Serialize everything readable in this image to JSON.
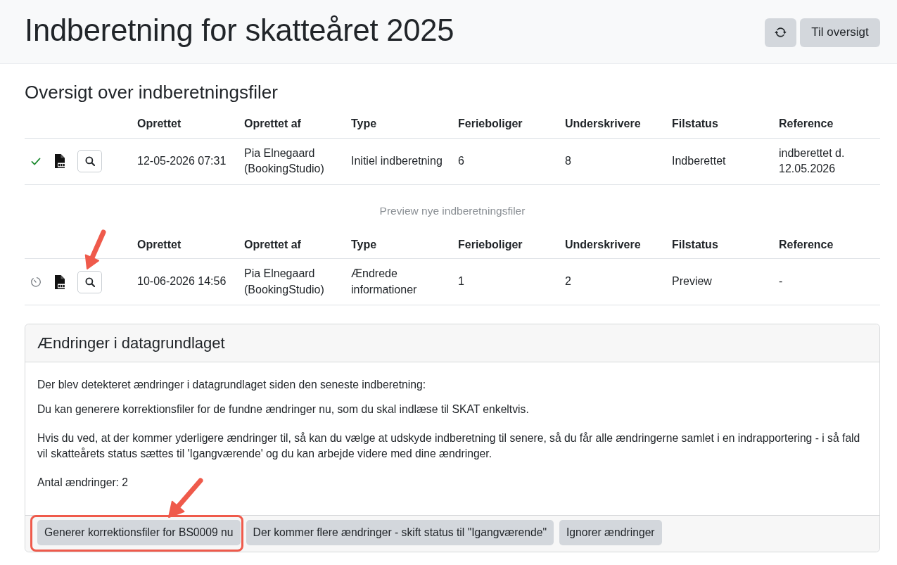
{
  "header": {
    "title": "Indberetning for skatteåret 2025",
    "overview_button": "Til oversigt"
  },
  "files_table": {
    "heading": "Oversigt over indberetningsfiler",
    "columns": [
      "Oprettet",
      "Oprettet af",
      "Type",
      "Ferieboliger",
      "Underskrivere",
      "Filstatus",
      "Reference"
    ],
    "rows": [
      {
        "kind": "submitted",
        "annotated": false,
        "cells": [
          "12-05-2026 07:31",
          "Pia Elnegaard (BookingStudio)",
          "Initiel indberetning",
          "6",
          "8",
          "Indberettet",
          "indberettet d. 12.05.2026"
        ]
      }
    ]
  },
  "preview_table": {
    "caption": "Preview nye indberetningsfiler",
    "columns": [
      "Oprettet",
      "Oprettet af",
      "Type",
      "Ferieboliger",
      "Underskrivere",
      "Filstatus",
      "Reference"
    ],
    "rows": [
      {
        "kind": "preview",
        "annotated": true,
        "cells": [
          "10-06-2026 14:56",
          "Pia Elnegaard (BookingStudio)",
          "Ændrede informationer",
          "1",
          "2",
          "Preview",
          "-"
        ]
      }
    ]
  },
  "changes_card": {
    "title": "Ændringer i datagrundlaget",
    "paragraphs": [
      "Der blev detekteret ændringer i datagrundlaget siden den seneste indberetning:",
      "Du kan generere korrektionsfiler for de fundne ændringer nu, som du skal indlæse til SKAT enkeltvis.",
      "Hvis du ved, at der kommer yderligere ændringer til, så kan du vælge at udskyde indberetning til senere, så du får alle ændringerne samlet i en indrapportering - i så fald vil skatteårets status sættes til 'Igangværende' og du kan arbejde videre med dine ændringer.",
      "Antal ændringer: 2"
    ],
    "buttons": [
      {
        "label": "Generer korrektionsfiler for BS0009 nu",
        "highlighted": true,
        "annotated": true
      },
      {
        "label": "Der kommer flere ændringer - skift status til \"Igangværende\"",
        "highlighted": false,
        "annotated": false
      },
      {
        "label": "Ignorer ændringer",
        "highlighted": false,
        "annotated": false
      }
    ]
  }
}
